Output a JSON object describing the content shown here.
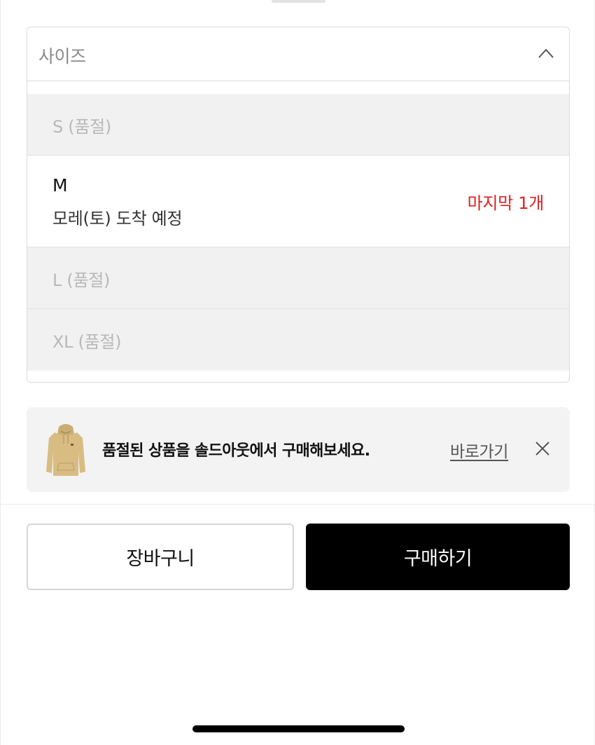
{
  "size_select": {
    "label": "사이즈",
    "icon": "chevron-up-icon",
    "options": [
      {
        "text": "S (품절)",
        "sold_out": true
      },
      {
        "size": "M",
        "sub": "모레(토) 도착 예정",
        "stock": "마지막 1개",
        "sold_out": false
      },
      {
        "text": "L (품절)",
        "sold_out": true
      },
      {
        "text": "XL (품절)",
        "sold_out": true
      }
    ]
  },
  "promo": {
    "text": "품절된 상품을 솔드아웃에서 구매해보세요.",
    "link": "바로가기",
    "thumbnail": "hoodie-thumbnail",
    "close_icon": "close-icon"
  },
  "actions": {
    "cart_label": "장바구니",
    "buy_label": "구매하기"
  },
  "colors": {
    "stock_alert": "#e02020",
    "primary_button": "#000000",
    "soldout_bg": "#f1f1f1"
  }
}
